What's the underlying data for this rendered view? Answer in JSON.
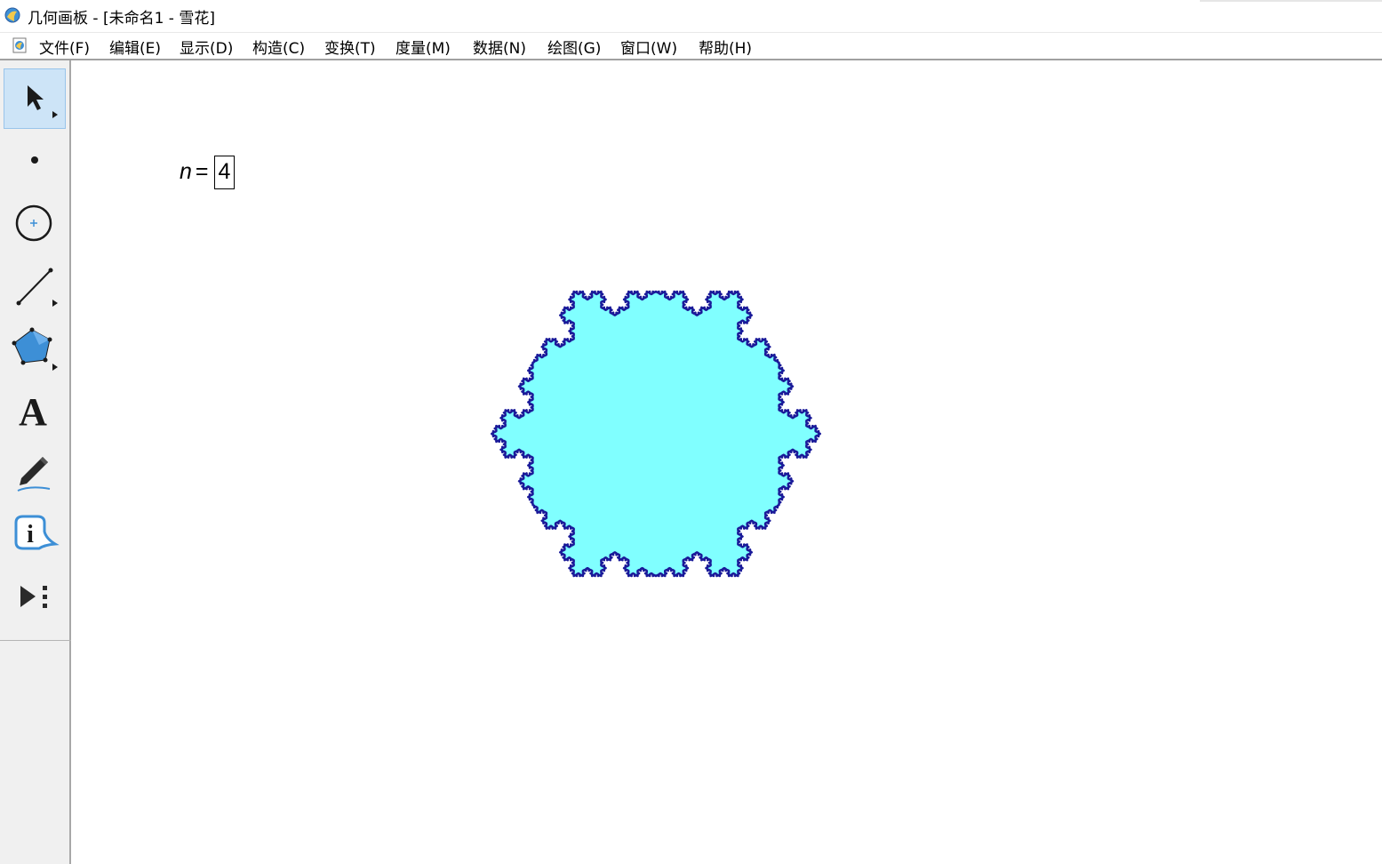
{
  "window": {
    "title": "几何画板 - [未命名1 - 雪花]"
  },
  "menu": [
    "文件(F)",
    "编辑(E)",
    "显示(D)",
    "构造(C)",
    "变换(T)",
    "度量(M)",
    "数据(N)",
    "绘图(G)",
    "窗口(W)",
    "帮助(H)"
  ],
  "toolbox": {
    "tools": [
      "arrow-select-tool",
      "point-tool",
      "compass-tool",
      "straightedge-tool",
      "polygon-tool",
      "text-tool",
      "marker-tool",
      "information-tool",
      "custom-tools"
    ],
    "text_tool_glyph": "A",
    "info_tool_glyph": "i",
    "selected_tool": "arrow-select-tool"
  },
  "canvas": {
    "parameter": {
      "name": "n",
      "equals": "=",
      "value": "4"
    },
    "snowflake": {
      "iterations": 4,
      "fill_color": "#80ffff",
      "stroke_color": "#1a1a99"
    }
  },
  "colors": {
    "accent_selected": "#cde4f7",
    "toolbox_bg": "#f0f0f0"
  }
}
